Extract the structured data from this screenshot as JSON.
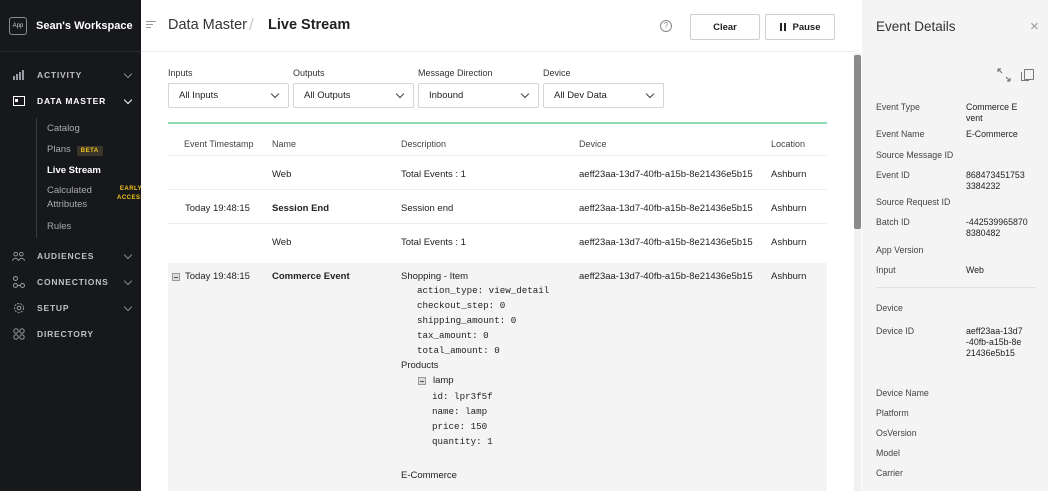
{
  "sidebar": {
    "app_icon": "App",
    "workspace": "Sean's Workspace",
    "nav": [
      {
        "label": "ACTIVITY",
        "icon": "bar-chart-icon"
      },
      {
        "label": "DATA MASTER",
        "icon": "data-table-icon"
      },
      {
        "label": "AUDIENCES",
        "icon": "people-icon"
      },
      {
        "label": "CONNECTIONS",
        "icon": "connections-icon"
      },
      {
        "label": "SETUP",
        "icon": "gear-icon"
      },
      {
        "label": "DIRECTORY",
        "icon": "grid-icon"
      }
    ],
    "sub": [
      {
        "label": "Catalog"
      },
      {
        "label": "Plans",
        "badge": "BETA"
      },
      {
        "label": "Live Stream"
      },
      {
        "label": "Calculated",
        "label2": "Attributes",
        "badge1": "EARLY",
        "badge2": "ACCESS"
      },
      {
        "label": "Rules"
      }
    ]
  },
  "header": {
    "crumb1": "Data Master",
    "crumb2": "Live Stream",
    "help": "?",
    "clear": "Clear",
    "pause": "Pause"
  },
  "filters": [
    {
      "label": "Inputs",
      "value": "All Inputs"
    },
    {
      "label": "Outputs",
      "value": "All Outputs"
    },
    {
      "label": "Message Direction",
      "value": "Inbound"
    },
    {
      "label": "Device",
      "value": "All Dev Data"
    }
  ],
  "table": {
    "columns": [
      "Event Timestamp",
      "Name",
      "Description",
      "Device",
      "Location"
    ],
    "rows": [
      {
        "timestamp": "",
        "name": "Web",
        "description": "Total Events : 1",
        "device": "aeff23aa-13d7-40fb-a15b-8e21436e5b15",
        "location": "Ashburn"
      },
      {
        "timestamp": "Today 19:48:15",
        "name": "Session End",
        "description": "Session end",
        "device": "aeff23aa-13d7-40fb-a15b-8e21436e5b15",
        "location": "Ashburn"
      },
      {
        "timestamp": "",
        "name": "Web",
        "description": "Total Events : 1",
        "device": "aeff23aa-13d7-40fb-a15b-8e21436e5b15",
        "location": "Ashburn"
      },
      {
        "timestamp": "Today 19:48:15",
        "name": "Commerce Event",
        "description": "Shopping - Item",
        "device": "aeff23aa-13d7-40fb-a15b-8e21436e5b15",
        "location": "Ashburn"
      }
    ],
    "expanded": {
      "attrs": [
        "action_type: view_detail",
        "checkout_step: 0",
        "shipping_amount: 0",
        "tax_amount: 0",
        "total_amount: 0"
      ],
      "products_label": "Products",
      "product_name": "lamp",
      "product_attrs": [
        "id: lpr3f5f",
        "name: lamp",
        "price: 150",
        "quantity: 1"
      ],
      "footer": "E-Commerce"
    }
  },
  "details": {
    "title": "Event Details",
    "close": "×",
    "fields": [
      {
        "key": "Event Type",
        "value": "Commerce Event"
      },
      {
        "key": "Event Name",
        "value": "E-Commerce"
      },
      {
        "key": "Source Message ID",
        "value": ""
      },
      {
        "key": "Event ID",
        "value": "8684734517533384232"
      },
      {
        "key": "Source Request ID",
        "value": ""
      },
      {
        "key": "Batch ID",
        "value": "-4425399658708380482"
      },
      {
        "key": "App Version",
        "value": ""
      },
      {
        "key": "Input",
        "value": "Web"
      }
    ],
    "device_section": "Device",
    "device_fields": [
      {
        "key": "Device ID",
        "value": "aeff23aa-13d7-40fb-a15b-8e21436e5b15"
      },
      {
        "key": "Device Name",
        "value": ""
      },
      {
        "key": "Platform",
        "value": ""
      },
      {
        "key": "OsVersion",
        "value": ""
      },
      {
        "key": "Model",
        "value": ""
      },
      {
        "key": "Carrier",
        "value": ""
      }
    ]
  },
  "colors": {
    "sidebar_bg": "#17181c",
    "accent_green": "#8fdcb2",
    "badge_yellow": "#f0c419"
  }
}
